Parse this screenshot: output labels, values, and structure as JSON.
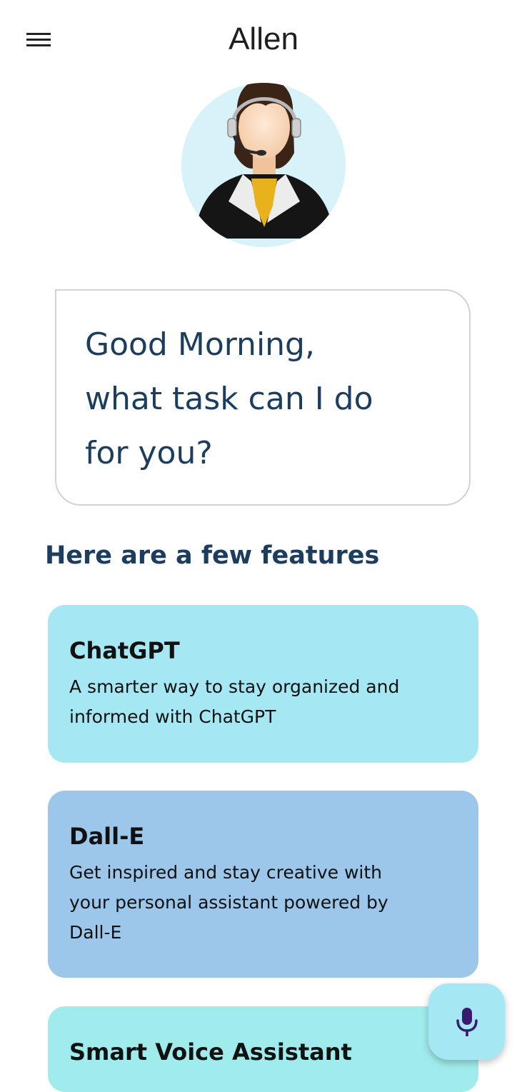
{
  "header": {
    "title": "Allen",
    "menu_icon": "hamburger-menu-icon"
  },
  "avatar": {
    "description_icon": "assistant-avatar",
    "circle_color": "#d7f3f9"
  },
  "greeting": {
    "line1": "Good Morning,",
    "line2": "what task can I do",
    "line3": "for you?"
  },
  "features": {
    "heading": "Here are a few features",
    "items": [
      {
        "title": "ChatGPT",
        "description_line1": "A smarter way to stay organized and",
        "description_line2": "informed with ChatGPT",
        "color": "#a6e7f4"
      },
      {
        "title": "Dall-E",
        "description_line1": "Get inspired and stay creative with",
        "description_line2": "your personal assistant powered by",
        "description_line3": "Dall-E",
        "color": "#9cc7ea"
      },
      {
        "title": "Smart Voice Assistant",
        "color": "#a0ecec"
      }
    ]
  },
  "mic_button": {
    "icon": "microphone-icon",
    "color": "#a6e7f4"
  },
  "colors": {
    "heading_text": "#1c3d5e",
    "mic_icon": "#3a1a6e"
  }
}
